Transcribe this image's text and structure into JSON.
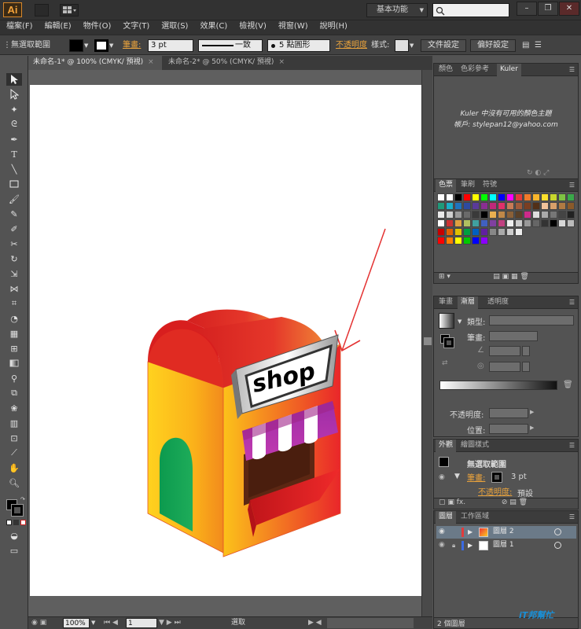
{
  "app": {
    "logo": "Ai",
    "workspace": "基本功能",
    "window_controls": [
      "–",
      "❐",
      "✕"
    ]
  },
  "menu": {
    "items": [
      "檔案(F)",
      "編輯(E)",
      "物件(O)",
      "文字(T)",
      "選取(S)",
      "效果(C)",
      "檢視(V)",
      "視窗(W)",
      "說明(H)"
    ]
  },
  "controlbar": {
    "selection_label": "無選取範圍",
    "stroke_label": "筆畫:",
    "stroke_value": "3 pt",
    "stroke_profile": "一致",
    "brush_value": "5 點圓形",
    "opacity_label": "不透明度",
    "style_label": "樣式:",
    "doc_setup_button": "文件設定",
    "prefs_button": "偏好設定"
  },
  "tabs": [
    {
      "label": "未命名-1* @ 100% (CMYK/ 預視)",
      "close": "×"
    },
    {
      "label": "未命名-2* @ 50% (CMYK/ 預視)",
      "close": "×"
    }
  ],
  "artwork": {
    "sign_text": "shop"
  },
  "statusbar": {
    "zoom": "100%",
    "artboard_num": "1",
    "tool_status": "選取"
  },
  "panels": {
    "top_tabs": [
      "顏色",
      "色彩參考",
      "Kuler"
    ],
    "kuler_message": "Kuler 中沒有可用的顏色主題",
    "kuler_account": "帳戶: stylepan12@yahoo.com",
    "swatch_tabs": [
      "色票",
      "筆刷",
      "符號"
    ],
    "gradient_tabs": [
      "筆畫",
      "漸層",
      "透明度"
    ],
    "gradient_type_label": "類型:",
    "gradient_stroke_label": "筆畫:",
    "gradient_opacity_label": "不透明度:",
    "gradient_position_label": "位置:",
    "appearance_tabs": [
      "外觀",
      "繪圖樣式"
    ],
    "appearance_title": "無選取範圍",
    "appearance_stroke_label": "筆畫:",
    "appearance_stroke_value": "3 pt",
    "appearance_opacity_label": "不透明度:",
    "appearance_opacity_value": "預設",
    "layers_tabs": [
      "圖層",
      "工作區域"
    ],
    "layers": [
      {
        "name": "圖層 2",
        "color": "#e23b3b",
        "active": true
      },
      {
        "name": "圖層 1",
        "color": "#3b6ae2",
        "active": false
      }
    ],
    "layers_count": "2 個圖層",
    "watermark": "iT邦幫忙"
  },
  "colors": {
    "accent_orange": "#e8a23c",
    "chrome_dark": "#323232",
    "panel_gray": "#535353",
    "layer_highlight": "#6b7a88"
  }
}
